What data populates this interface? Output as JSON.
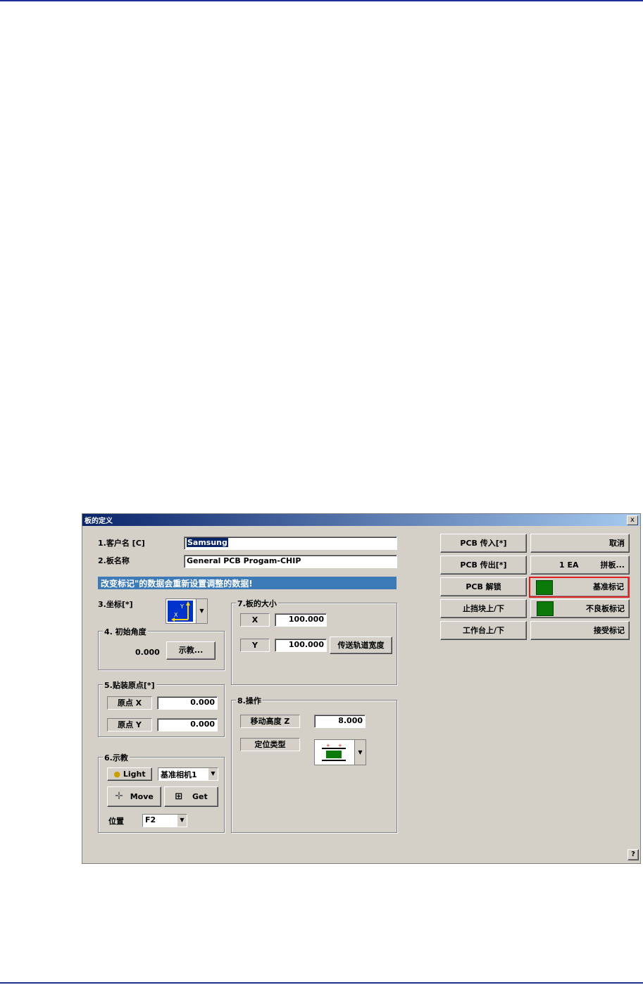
{
  "dialog": {
    "title": "板的定义",
    "close_label": "x",
    "help_label": "?"
  },
  "customer": {
    "label": "1.客户名 [C]",
    "value": "Samsung"
  },
  "board_name": {
    "label": "2.板名称",
    "value": "General PCB Progam-CHIP"
  },
  "banner": "改变标记\"的数据会重新设置调整的数据!",
  "coordinate": {
    "label": "3.坐标[*]",
    "icon": "coordinate-axes-icon"
  },
  "initial_angle": {
    "label": "4. 初始角度",
    "value": "0.000",
    "teach_button": "示教..."
  },
  "mount_origin": {
    "label": "5.贴装原点[*]",
    "x_label": "原点 X",
    "x_value": "0.000",
    "y_label": "原点 Y",
    "y_value": "0.000"
  },
  "teach": {
    "label": "6.示教",
    "light_button": "Light",
    "camera_select": "基准相机1",
    "move_button": "Move",
    "get_button": "Get",
    "position_label": "位置",
    "position_select": "F2"
  },
  "board_size": {
    "label": "7.板的大小",
    "x_label": "X",
    "x_value": "100.000",
    "y_label": "Y",
    "y_value": "100.000",
    "conveyor_button": "传送轨道宽度"
  },
  "operation": {
    "label": "8.操作",
    "move_height_label": "移动高度 Z",
    "move_height_value": "8.000",
    "locate_type_label": "定位类型"
  },
  "right_buttons": {
    "pcb_in": "PCB 传入[*]",
    "cancel": "取消",
    "pcb_out": "PCB 传出[*]",
    "array_count": "1 EA",
    "array": "拼板...",
    "pcb_unlock": "PCB 解锁",
    "fiducial": "基准标记",
    "stopper": "止挡块上/下",
    "bad_mark": "不良板标记",
    "table": "工作台上/下",
    "accept_mark": "接受标记"
  },
  "colors": {
    "highlight": "#e02020",
    "banner": "#3d7ab8",
    "titlebar": "#0a246a",
    "mark_green": "#0b7a0b"
  }
}
